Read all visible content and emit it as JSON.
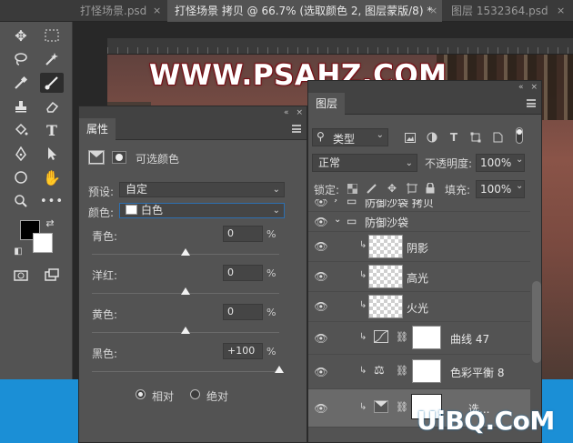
{
  "tabs": [
    {
      "label": "打怪场景.psd",
      "close": "×",
      "active": false
    },
    {
      "label": "打怪场景 拷贝 @ 66.7% (选取颜色 2, 图层蒙版/8) *",
      "close": "×",
      "active": true
    },
    {
      "label": "图层 1532364.psd",
      "close": "×",
      "active": false
    }
  ],
  "canvas": {
    "watermark": "WWW.PSAHZ.COM"
  },
  "properties": {
    "title": "属性",
    "adjustment_name": "可选颜色",
    "preset_label": "预设:",
    "preset_value": "自定",
    "colors_label": "颜色:",
    "colors_value": "白色",
    "sliders": [
      {
        "label": "青色:",
        "value": "0",
        "unit": "%",
        "level": 0
      },
      {
        "label": "洋红:",
        "value": "0",
        "unit": "%",
        "level": 0
      },
      {
        "label": "黄色:",
        "value": "0",
        "unit": "%",
        "level": 0
      },
      {
        "label": "黑色:",
        "value": "+100",
        "unit": "%",
        "level": 100
      }
    ],
    "mode_relative": "相对",
    "mode_absolute": "绝对",
    "mode_selected": "relative"
  },
  "layers": {
    "title": "图层",
    "filter_label": "类型",
    "blend_mode": "正常",
    "opacity_label": "不透明度:",
    "opacity_value": "100%",
    "lock_label": "锁定:",
    "fill_label": "填充:",
    "fill_value": "100%",
    "items": [
      {
        "name": "防御沙袋 拷贝",
        "kind": "group-collapsed",
        "selected": false
      },
      {
        "name": "防御沙袋",
        "kind": "group-open",
        "selected": false
      },
      {
        "name": "阴影",
        "kind": "pixel",
        "selected": false
      },
      {
        "name": "高光",
        "kind": "pixel",
        "selected": false
      },
      {
        "name": "火光",
        "kind": "pixel",
        "selected": false
      },
      {
        "name": "曲线 47",
        "kind": "curves",
        "selected": false
      },
      {
        "name": "色彩平衡 8",
        "kind": "color-balance",
        "selected": false
      },
      {
        "name": "选...",
        "kind": "selective-color",
        "selected": true
      }
    ]
  },
  "footer_brand": "UiBQ.CoM",
  "colors": {
    "accent_blue": "#1b8fd6",
    "panel": "#535353",
    "dark": "#282828"
  }
}
